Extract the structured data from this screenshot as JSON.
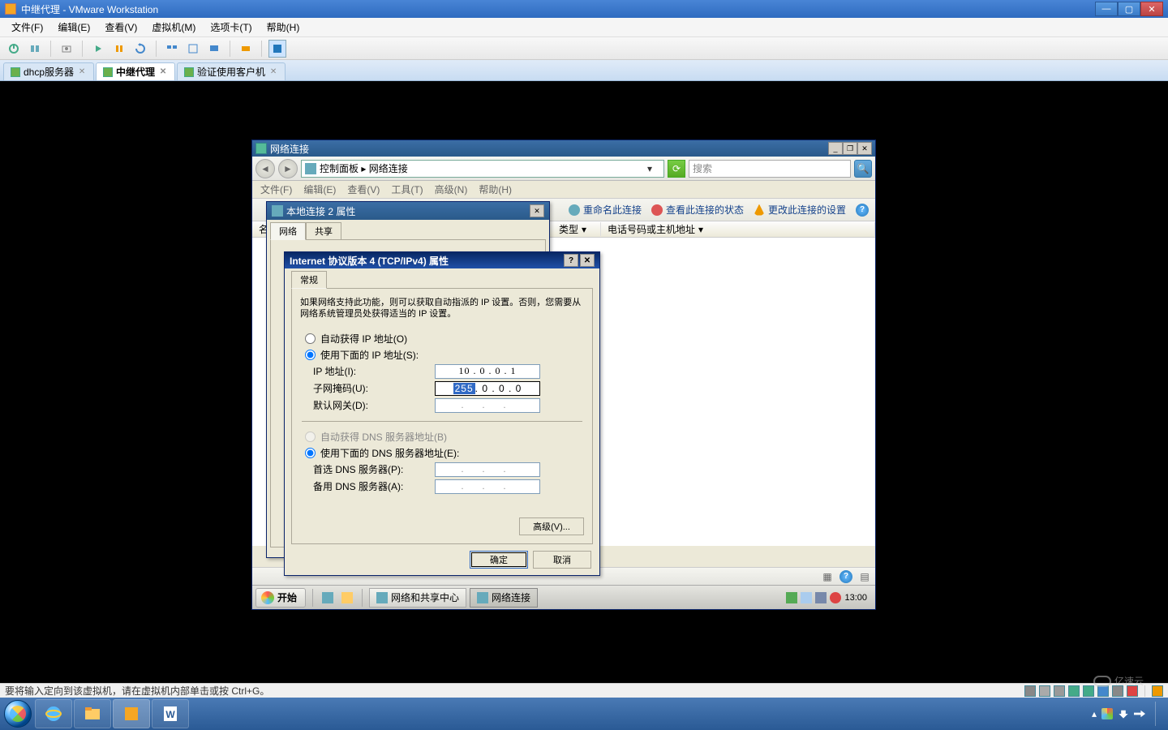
{
  "vmware": {
    "title": "中继代理 - VMware Workstation",
    "menu": {
      "file": "文件(F)",
      "edit": "编辑(E)",
      "view": "查看(V)",
      "vm": "虚拟机(M)",
      "tabs": "选项卡(T)",
      "help": "帮助(H)"
    },
    "tabs": [
      {
        "label": "dhcp服务器",
        "active": false
      },
      {
        "label": "中继代理",
        "active": true
      },
      {
        "label": "验证使用客户机",
        "active": false
      }
    ],
    "status_hint": "要将输入定向到该虚拟机，请在虚拟机内部单击或按 Ctrl+G。"
  },
  "guest": {
    "explorer": {
      "title": "网络连接",
      "breadcrumb": "控制面板 ▸ 网络连接",
      "search_placeholder": "搜索",
      "menu": {
        "file": "文件(F)",
        "edit": "编辑(E)",
        "view": "查看(V)",
        "tools": "工具(T)",
        "advanced": "高级(N)",
        "help": "帮助(H)"
      },
      "cmdbar": {
        "rename": "重命名此连接",
        "status": "查看此连接的状态",
        "change": "更改此连接的设置"
      },
      "columns": {
        "name": "名",
        "type": "类型",
        "phone": "电话号码或主机地址"
      }
    },
    "dlg_conn": {
      "title": "本地连接 2 属性",
      "tab_network": "网络",
      "tab_share": "共享"
    },
    "dlg_ip": {
      "title": "Internet 协议版本 4 (TCP/IPv4) 属性",
      "tab_general": "常规",
      "desc": "如果网络支持此功能，则可以获取自动指派的 IP 设置。否则，您需要从网络系统管理员处获得适当的 IP 设置。",
      "radio_auto_ip": "自动获得 IP 地址(O)",
      "radio_manual_ip": "使用下面的 IP 地址(S):",
      "label_ip": "IP 地址(I):",
      "label_mask": "子网掩码(U):",
      "label_gw": "默认网关(D):",
      "radio_auto_dns": "自动获得 DNS 服务器地址(B)",
      "radio_manual_dns": "使用下面的 DNS 服务器地址(E):",
      "label_dns1": "首选 DNS 服务器(P):",
      "label_dns2": "备用 DNS 服务器(A):",
      "ip_value": "10 . 0 . 0 . 1",
      "mask_oct1": "255",
      "mask_rest": " . 0 . 0 . 0",
      "gw_value": ". . .",
      "dns1_value": ". . .",
      "dns2_value": ". . .",
      "btn_advanced": "高级(V)...",
      "btn_ok": "确定",
      "btn_cancel": "取消"
    },
    "taskbar": {
      "start": "开始",
      "task1": "网络和共享中心",
      "task2": "网络连接",
      "clock": "13:00"
    }
  },
  "watermark": "亿速云"
}
